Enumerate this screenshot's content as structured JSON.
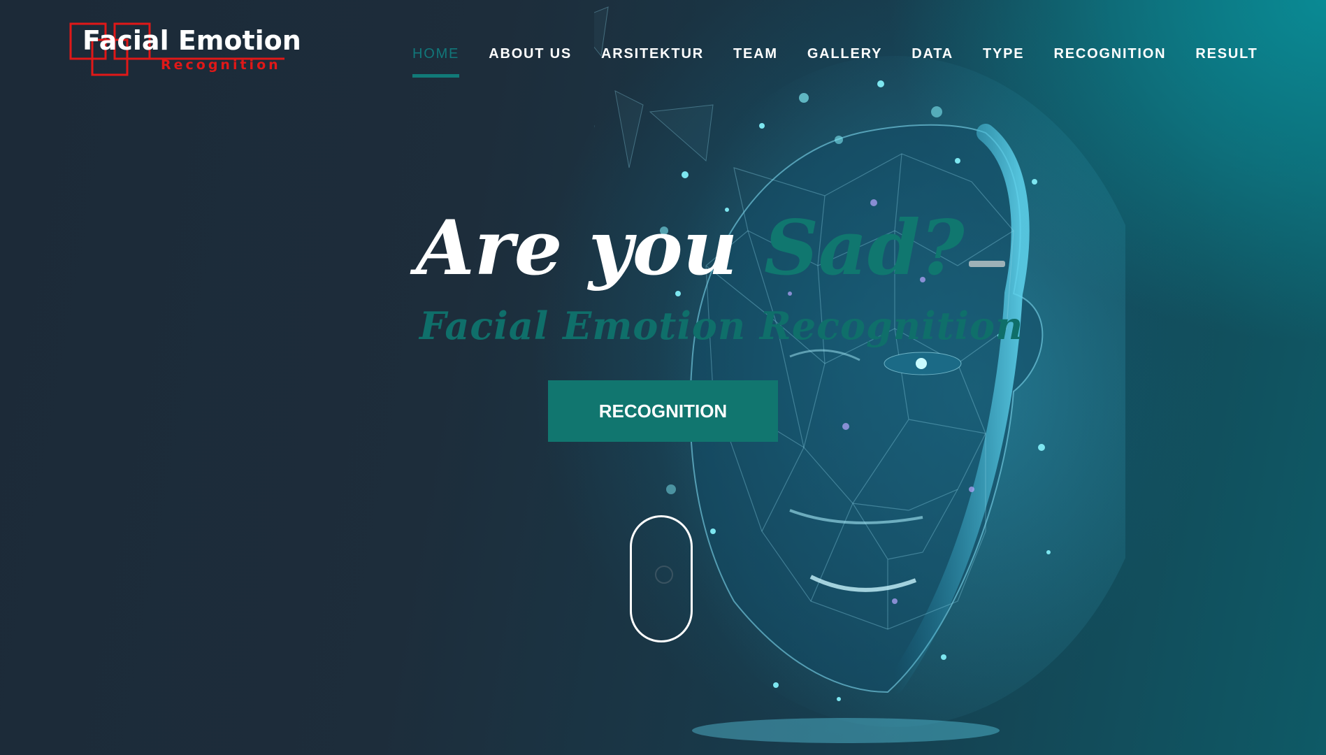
{
  "brand": {
    "title": "Facial Emotion",
    "subtitle": "Recognition",
    "accent_color": "#e01818"
  },
  "nav": {
    "items": [
      {
        "label": "HOME",
        "active": true
      },
      {
        "label": "ABOUT US"
      },
      {
        "label": "ARSITEKTUR"
      },
      {
        "label": "TEAM"
      },
      {
        "label": "GALLERY"
      },
      {
        "label": "DATA"
      },
      {
        "label": "TYPE"
      },
      {
        "label": "RECOGNITION"
      },
      {
        "label": "RESULT"
      }
    ],
    "active_color": "#11777a"
  },
  "hero": {
    "headline_prefix": "Are you",
    "headline_emotion": "Sad?",
    "subheadline": "Facial Emotion Recognition",
    "cta_label": "RECOGNITION",
    "accent_color": "#11766f"
  },
  "scroll_indicator": {
    "icon": "mouse-scroll-icon"
  }
}
